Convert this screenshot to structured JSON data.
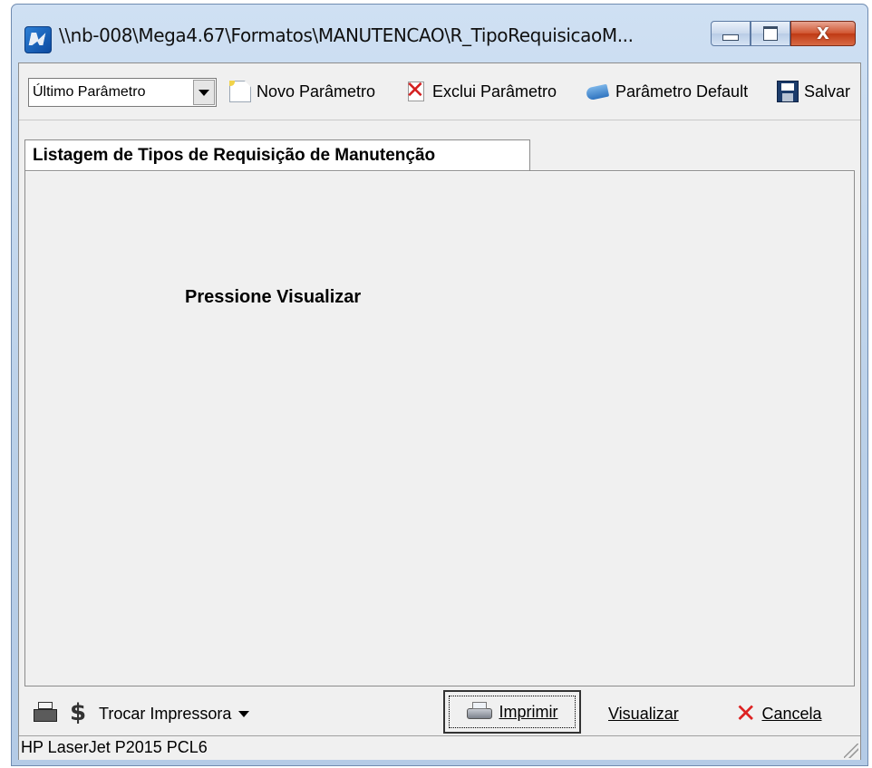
{
  "window": {
    "title": "\\\\nb-008\\Mega4.67\\Formatos\\MANUTENCAO\\R_TipoRequisicaoM...",
    "close_glyph": "X"
  },
  "toolbar": {
    "param_select": "Último Parâmetro",
    "new_param": "Novo Parâmetro",
    "delete_param": "Exclui Parâmetro",
    "default_param": "Parâmetro Default",
    "save": "Salvar"
  },
  "tabs": [
    {
      "label": "Listagem de Tipos de Requisição de Manutenção"
    }
  ],
  "page": {
    "hint": "Pressione Visualizar"
  },
  "bottom": {
    "swap_printer": "Trocar Impressora",
    "print": "Imprimir",
    "preview": "Visualizar",
    "cancel": "Cancela"
  },
  "status": {
    "printer": "HP LaserJet P2015 PCL6"
  },
  "colors": {
    "close_button": "#c03a14",
    "cancel_icon": "#d22222",
    "frame": "#b9cfe8"
  }
}
